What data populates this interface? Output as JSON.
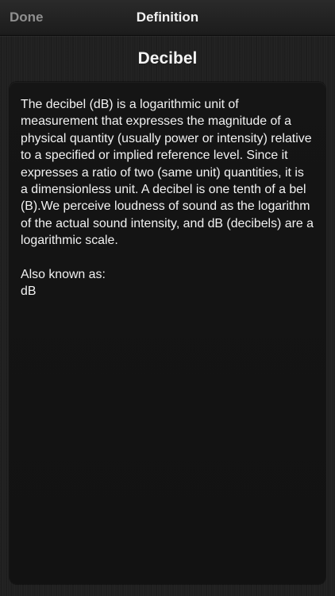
{
  "nav": {
    "done_label": "Done",
    "title": "Definition"
  },
  "term": {
    "title": "Decibel",
    "definition": "The decibel (dB) is a logarithmic unit of measurement that expresses the magnitude of a physical quantity (usually power or intensity) relative to a specified or implied reference level. Since it expresses a ratio of two (same unit) quantities, it is a dimensionless unit. A decibel is one tenth of a bel (B).We perceive loudness of sound as the logarithm of the actual sound intensity, and dB (decibels) are a logarithmic scale.",
    "aka_label": "Also known as:",
    "aka_value": "dB"
  },
  "colors": {
    "background": "#202020",
    "nav_background": "#222222",
    "card_background": "#141414",
    "text": "#f2f2f2",
    "done_text": "#8f8f8f"
  }
}
